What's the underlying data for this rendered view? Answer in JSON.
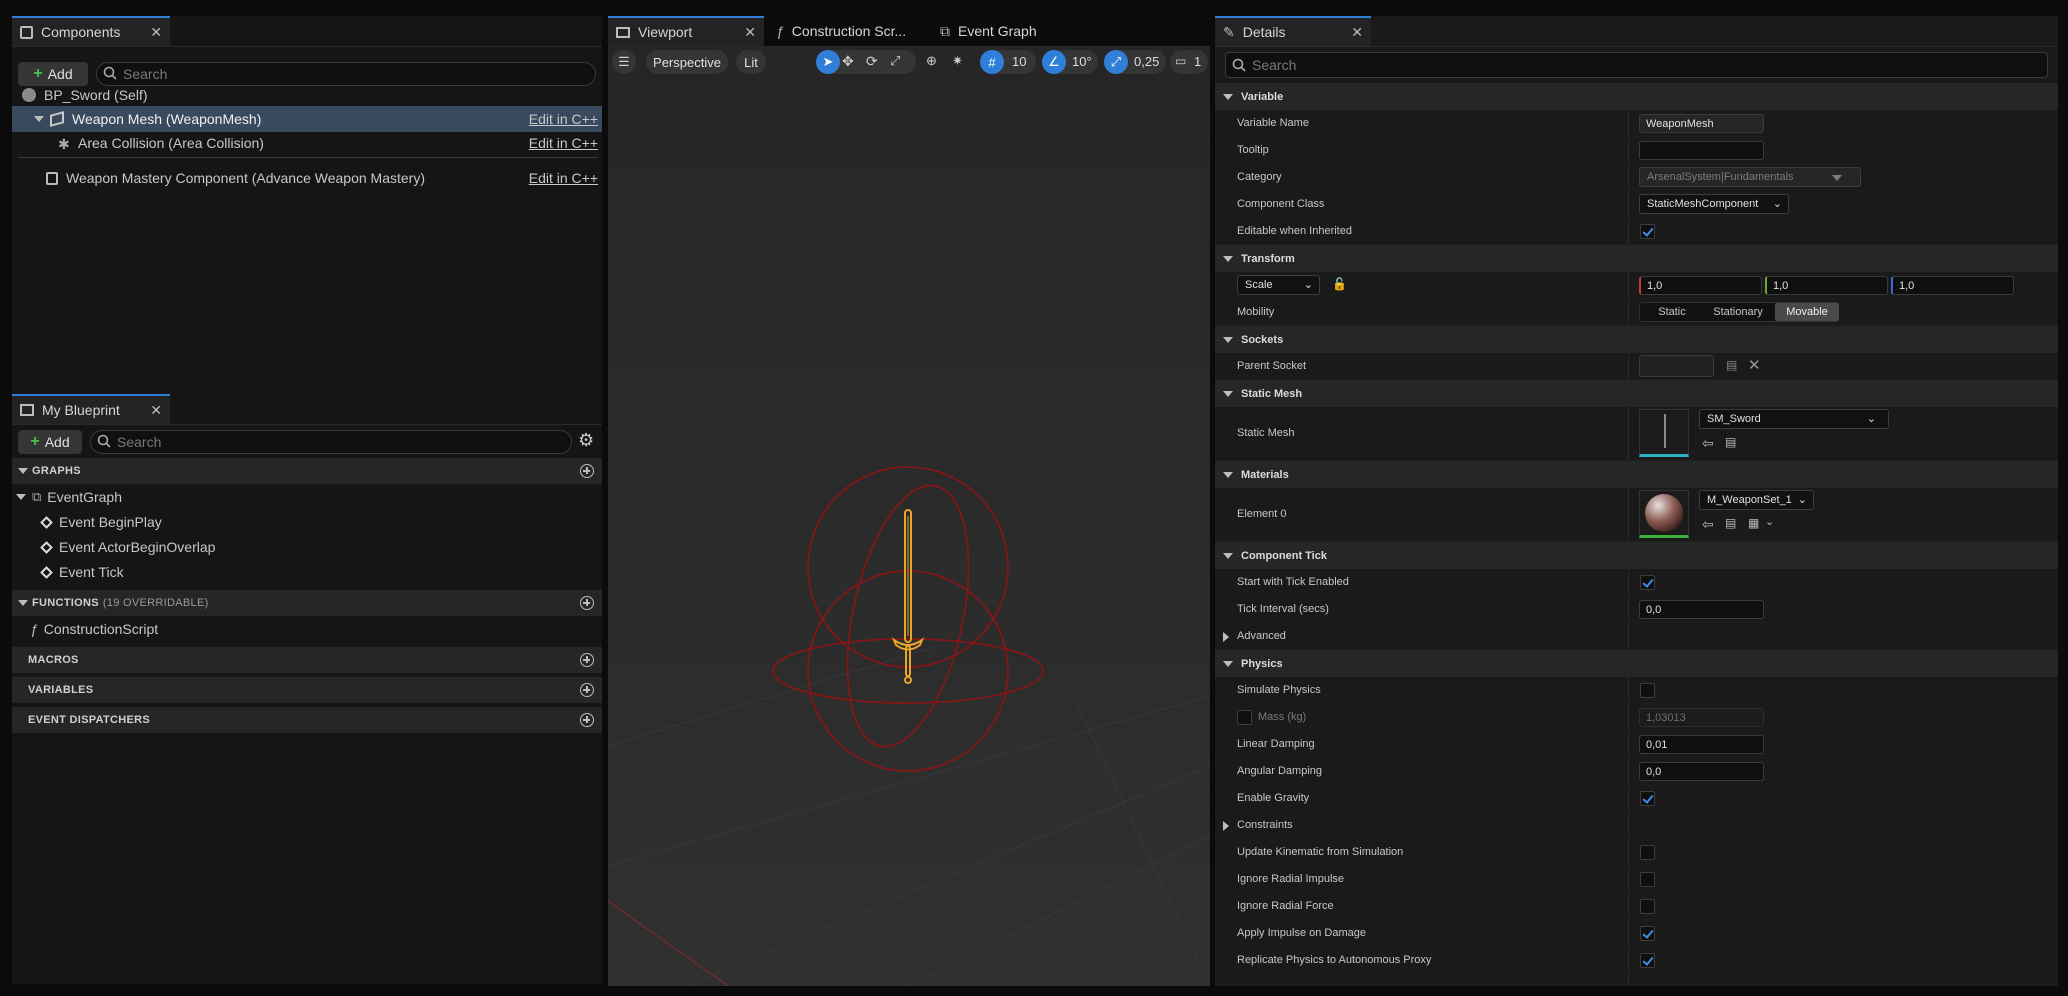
{
  "components_panel": {
    "tab_label": "Components",
    "add_label": "Add",
    "search_placeholder": "Search",
    "tree": {
      "root": "BP_Sword (Self)",
      "selected": "Weapon Mesh (WeaponMesh)",
      "child": "Area Collision (Area Collision)",
      "other": "Weapon Mastery Component (Advance Weapon Mastery)",
      "edit_label": "Edit in C++"
    }
  },
  "my_blueprint": {
    "tab_label": "My Blueprint",
    "add_label": "Add",
    "search_placeholder": "Search",
    "graphs_label": "GRAPHS",
    "event_graph": "EventGraph",
    "events": [
      "Event BeginPlay",
      "Event ActorBeginOverlap",
      "Event Tick"
    ],
    "functions_label": "FUNCTIONS",
    "functions_count": "(19 OVERRIDABLE)",
    "construction_script": "ConstructionScript",
    "macros_label": "MACROS",
    "variables_label": "VARIABLES",
    "dispatchers_label": "EVENT DISPATCHERS"
  },
  "viewport_tabs": {
    "viewport": "Viewport",
    "construction": "Construction Scr...",
    "event_graph": "Event Graph"
  },
  "viewport_toolbar": {
    "perspective": "Perspective",
    "lit": "Lit",
    "grid_snap": "10",
    "rot_snap": "10°",
    "scale_snap": "0,25",
    "camera_speed": "1"
  },
  "details": {
    "tab_label": "Details",
    "search_placeholder": "Search",
    "sections": {
      "variable": "Variable",
      "transform": "Transform",
      "sockets": "Sockets",
      "static_mesh": "Static Mesh",
      "materials": "Materials",
      "component_tick": "Component Tick",
      "physics": "Physics"
    },
    "labels": {
      "variable_name": "Variable Name",
      "tooltip": "Tooltip",
      "category": "Category",
      "component_class": "Component Class",
      "editable_inherited": "Editable when Inherited",
      "scale": "Scale",
      "mobility": "Mobility",
      "parent_socket": "Parent Socket",
      "static_mesh": "Static Mesh",
      "element0": "Element 0",
      "start_tick": "Start with Tick Enabled",
      "tick_interval": "Tick Interval (secs)",
      "advanced": "Advanced",
      "simulate_physics": "Simulate Physics",
      "mass": "Mass (kg)",
      "linear_damping": "Linear Damping",
      "angular_damping": "Angular Damping",
      "enable_gravity": "Enable Gravity",
      "constraints": "Constraints",
      "update_kinematic": "Update Kinematic from Simulation",
      "ignore_radial_impulse": "Ignore Radial Impulse",
      "ignore_radial_force": "Ignore Radial Force",
      "apply_impulse": "Apply Impulse on Damage",
      "replicate_physics": "Replicate Physics to Autonomous Proxy"
    },
    "values": {
      "variable_name": "WeaponMesh",
      "tooltip": "",
      "category": "ArsenalSystem|Fundamentals",
      "component_class": "StaticMeshComponent",
      "scale_x": "1,0",
      "scale_y": "1,0",
      "scale_z": "1,0",
      "mobility_static": "Static",
      "mobility_stationary": "Stationary",
      "mobility_movable": "Movable",
      "static_mesh": "SM_Sword",
      "material": "M_WeaponSet_1",
      "tick_interval": "0,0",
      "mass": "1,03013",
      "linear_damping": "0,01",
      "angular_damping": "0,0"
    },
    "checks": {
      "editable_inherited": true,
      "start_tick": true,
      "simulate_physics": false,
      "mass": false,
      "enable_gravity": true,
      "update_kinematic": false,
      "ignore_radial_impulse": false,
      "ignore_radial_force": false,
      "apply_impulse": true,
      "replicate_physics": true
    }
  },
  "colors": {
    "accent": "#2f7fd8",
    "selection": "#3a4a5e",
    "sword": "#e8a52a",
    "sphere": "#8e1414"
  }
}
